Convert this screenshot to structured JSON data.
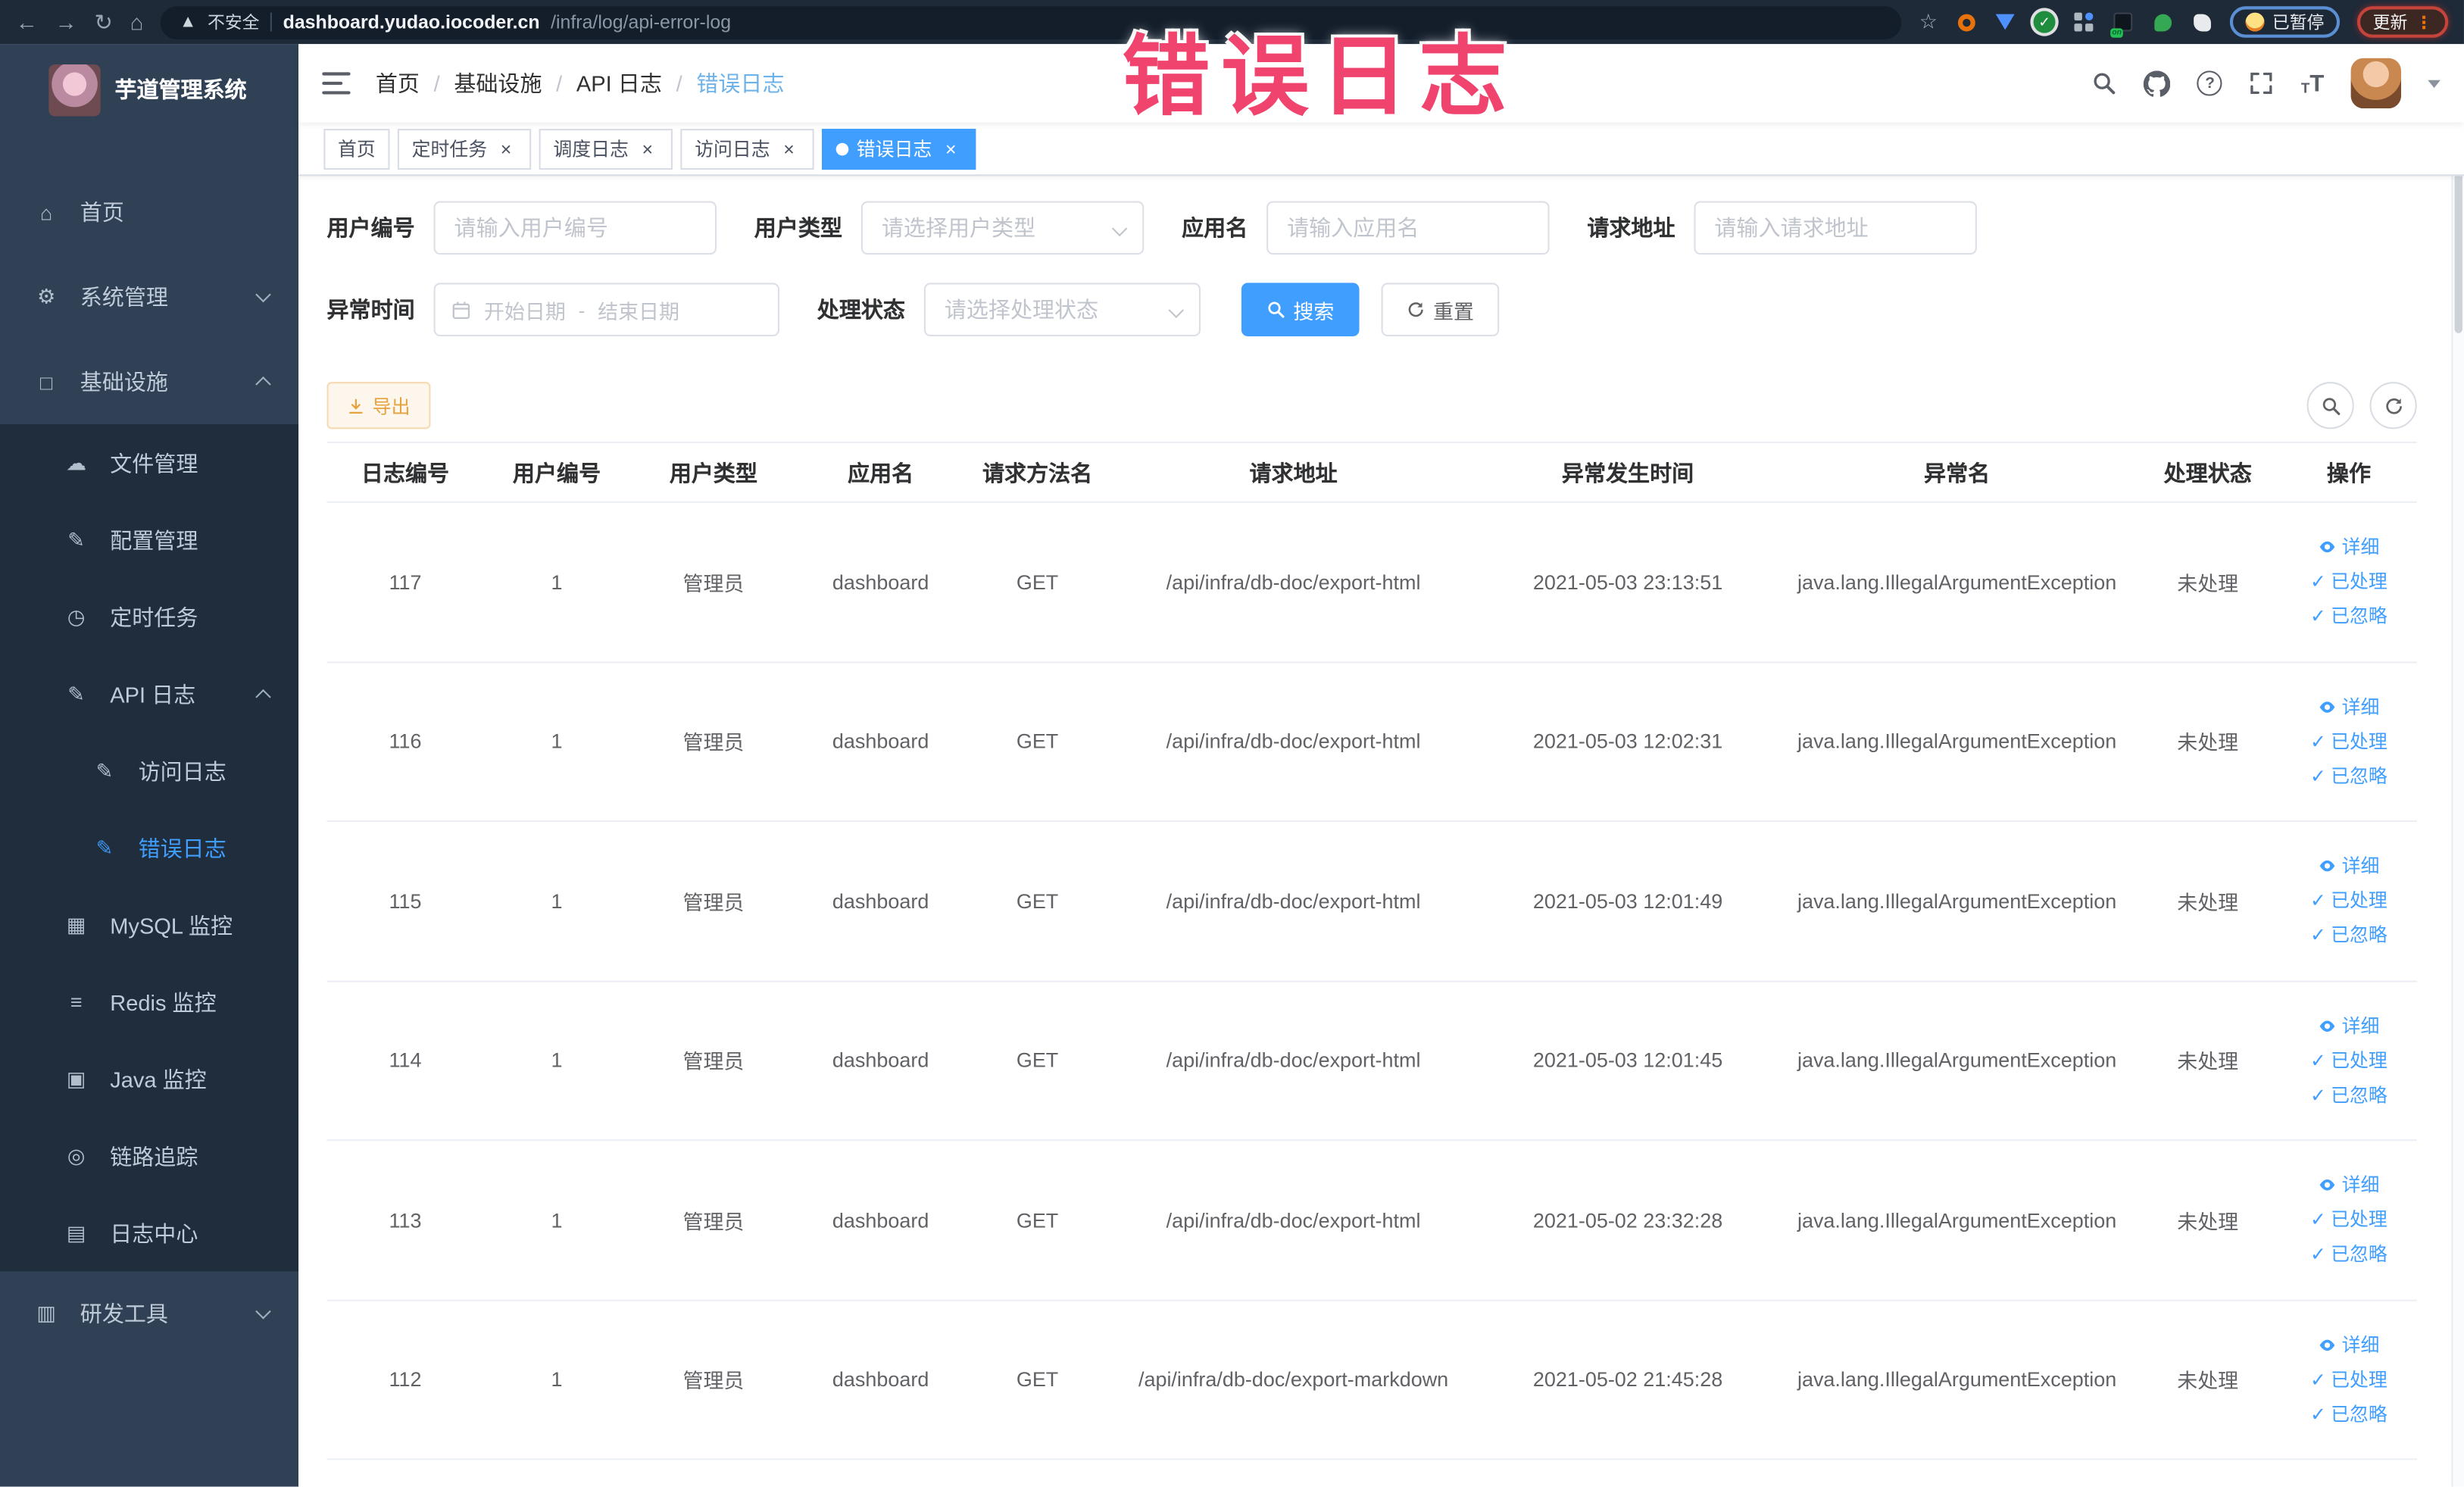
{
  "colors": {
    "accent": "#409eff",
    "warning": "#e6a23c",
    "watermark_pink": "#f0436e",
    "sidebar_bg": "#304156",
    "submenu_bg": "#1f2d3d",
    "sidebar_text": "#bfcbd9"
  },
  "watermark_text": "错误日志",
  "browser": {
    "security_label": "不安全",
    "url_domain": "dashboard.yudao.iocoder.cn",
    "url_path": "/infra/log/api-error-log",
    "paused_badge_label": "已暂停",
    "update_button_label": "更新"
  },
  "sidebar": {
    "title": "芋道管理系统",
    "items": [
      {
        "id": "home",
        "label": "首页",
        "icon": "home-icon",
        "level": 1
      },
      {
        "id": "system-management",
        "label": "系统管理",
        "icon": "gear-icon",
        "level": 1,
        "chevron": "down"
      },
      {
        "id": "infrastructure",
        "label": "基础设施",
        "icon": "infrastructure-icon",
        "level": 1,
        "chevron": "up"
      },
      {
        "id": "file-management",
        "label": "文件管理",
        "icon": "file-manage-icon",
        "level": 2
      },
      {
        "id": "config-management",
        "label": "配置管理",
        "icon": "config-manage-icon",
        "level": 2
      },
      {
        "id": "scheduled-tasks",
        "label": "定时任务",
        "icon": "scheduled-task-icon",
        "level": 2
      },
      {
        "id": "api-log",
        "label": "API 日志",
        "icon": "api-log-icon",
        "level": 2,
        "chevron": "up"
      },
      {
        "id": "access-log",
        "label": "访问日志",
        "icon": "access-log-icon",
        "level": 3
      },
      {
        "id": "error-log",
        "label": "错误日志",
        "icon": "error-log-icon",
        "level": 3,
        "active": true
      },
      {
        "id": "mysql-monitor",
        "label": "MySQL 监控",
        "icon": "mysql-monitor-icon",
        "level": 2
      },
      {
        "id": "redis-monitor",
        "label": "Redis 监控",
        "icon": "redis-monitor-icon",
        "level": 2
      },
      {
        "id": "java-monitor",
        "label": "Java 监控",
        "icon": "java-monitor-icon",
        "level": 2
      },
      {
        "id": "trace",
        "label": "链路追踪",
        "icon": "trace-icon",
        "level": 2
      },
      {
        "id": "log-center",
        "label": "日志中心",
        "icon": "log-center-icon",
        "level": 2
      },
      {
        "id": "dev-tools",
        "label": "研发工具",
        "icon": "devtools-icon",
        "level": 1,
        "chevron": "down"
      }
    ]
  },
  "breadcrumb": [
    "首页",
    "基础设施",
    "API 日志",
    "错误日志"
  ],
  "tags": [
    {
      "id": "home",
      "label": "首页",
      "closable": false,
      "active": false
    },
    {
      "id": "scheduled-tasks",
      "label": "定时任务",
      "closable": true,
      "active": false
    },
    {
      "id": "schedule-log",
      "label": "调度日志",
      "closable": true,
      "active": false
    },
    {
      "id": "access-log",
      "label": "访问日志",
      "closable": true,
      "active": false
    },
    {
      "id": "error-log",
      "label": "错误日志",
      "closable": true,
      "active": true
    }
  ],
  "filters": {
    "user_id": {
      "label": "用户编号",
      "placeholder": "请输入用户编号"
    },
    "user_type": {
      "label": "用户类型",
      "placeholder": "请选择用户类型"
    },
    "app_name": {
      "label": "应用名",
      "placeholder": "请输入应用名"
    },
    "request_url": {
      "label": "请求地址",
      "placeholder": "请输入请求地址"
    },
    "exception_time": {
      "label": "异常时间",
      "start_placeholder": "开始日期",
      "separator": "-",
      "end_placeholder": "结束日期"
    },
    "process_status": {
      "label": "处理状态",
      "placeholder": "请选择处理状态"
    },
    "search_label": "搜索",
    "reset_label": "重置"
  },
  "toolbar": {
    "export_label": "导出"
  },
  "table": {
    "headers": [
      "日志编号",
      "用户编号",
      "用户类型",
      "应用名",
      "请求方法名",
      "请求地址",
      "异常发生时间",
      "异常名",
      "处理状态",
      "操作"
    ],
    "rows": [
      [
        "117",
        "1",
        "管理员",
        "dashboard",
        "GET",
        "/api/infra/db-doc/export-html",
        "2021-05-03 23:13:51",
        "java.lang.IllegalArgumentException",
        "未处理"
      ],
      [
        "116",
        "1",
        "管理员",
        "dashboard",
        "GET",
        "/api/infra/db-doc/export-html",
        "2021-05-03 12:02:31",
        "java.lang.IllegalArgumentException",
        "未处理"
      ],
      [
        "115",
        "1",
        "管理员",
        "dashboard",
        "GET",
        "/api/infra/db-doc/export-html",
        "2021-05-03 12:01:49",
        "java.lang.IllegalArgumentException",
        "未处理"
      ],
      [
        "114",
        "1",
        "管理员",
        "dashboard",
        "GET",
        "/api/infra/db-doc/export-html",
        "2021-05-03 12:01:45",
        "java.lang.IllegalArgumentException",
        "未处理"
      ],
      [
        "113",
        "1",
        "管理员",
        "dashboard",
        "GET",
        "/api/infra/db-doc/export-html",
        "2021-05-02 23:32:28",
        "java.lang.IllegalArgumentException",
        "未处理"
      ],
      [
        "112",
        "1",
        "管理员",
        "dashboard",
        "GET",
        "/api/infra/db-doc/export-markdown",
        "2021-05-02 21:45:28",
        "java.lang.IllegalArgumentException",
        "未处理"
      ]
    ],
    "row_actions": [
      {
        "id": "detail",
        "label": "详细",
        "icon": "eye-icon"
      },
      {
        "id": "mark-processed",
        "label": "已处理",
        "icon": "check-icon"
      },
      {
        "id": "mark-ignored",
        "label": "已忽略",
        "icon": "check-icon"
      }
    ]
  }
}
